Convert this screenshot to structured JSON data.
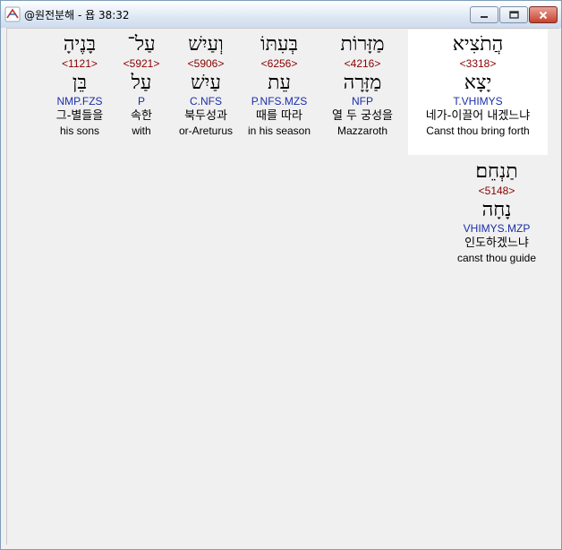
{
  "window": {
    "title": "@원전분해 - 욥 38:32"
  },
  "colors": {
    "strong_number": "#8b0000",
    "morph_code": "#1a2ea8",
    "text": "#000000",
    "background": "#f0f0f0",
    "selected_bg": "#ffffff"
  },
  "words": [
    {
      "hebrew": "הֲתֹצִיא",
      "strong": "<3318>",
      "root": "יָצָא",
      "morph": "T.VHIMYS",
      "korean": "네가-이끌어 내겠느냐",
      "english": "Canst thou bring forth"
    },
    {
      "hebrew": "מַזָּרוֹת",
      "strong": "<4216>",
      "root": "מַזָּרָה",
      "morph": "NFP",
      "korean": "열 두 궁성을",
      "english": "Mazzaroth"
    },
    {
      "hebrew": "בְּעִתּוֹ",
      "strong": "<6256>",
      "root": "עֵת",
      "morph": "P.NFS.MZS",
      "korean": "때를 따라",
      "english": "in his season"
    },
    {
      "hebrew": "וְעַיִשׁ",
      "strong": "<5906>",
      "root": "עַיִשׁ",
      "morph": "C.NFS",
      "korean": "북두성과",
      "english": "or-Areturus"
    },
    {
      "hebrew": "עַל־",
      "strong": "<5921>",
      "root": "עַל",
      "morph": "P",
      "korean": "속한",
      "english": "with"
    },
    {
      "hebrew": "בָּנֶיהָ",
      "strong": "<1121>",
      "root": "בֵּן",
      "morph": "NMP.FZS",
      "korean": "그-별들을",
      "english": "his sons"
    },
    {
      "hebrew": "תַנְחֵם׃",
      "strong": "<5148>",
      "root": "נָחָה",
      "morph": "VHIMYS.MZP",
      "korean": "인도하겠느냐",
      "english": "canst thou guide"
    }
  ]
}
